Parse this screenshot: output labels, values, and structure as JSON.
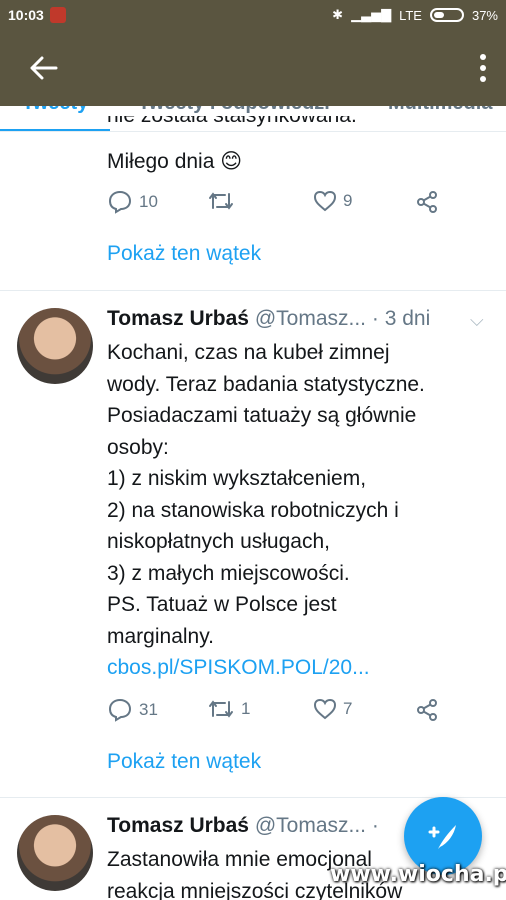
{
  "status_bar": {
    "time": "10:03",
    "network": "LTE",
    "battery": "37%"
  },
  "tabs": [
    "Tweety",
    "Tweety i odpowiedzi",
    "Multimedia"
  ],
  "tweets": [
    {
      "partial_text_1": "nie została stałsynkowana.",
      "partial_text_2": "Miłego dnia 😊",
      "replies": "10",
      "retweets": "",
      "likes": "9",
      "show_thread": "Pokaż ten wątek"
    },
    {
      "name": "Tomasz Urbaś",
      "handle": "@Tomasz...",
      "time": "· 3 dni",
      "text_lines": [
        "Kochani, czas na kubeł zimnej",
        "wody. Teraz badania statystyczne.",
        "Posiadaczami tatuaży są głównie",
        "osoby:",
        "1) z niskim wykształceniem,",
        "2) na stanowiska robotniczych i",
        "niskopłatnych usługach,",
        "3) z małych miejscowości.",
        "PS. Tatuaż w Polsce jest",
        "marginalny."
      ],
      "link": "cbos.pl/SPISKOM.POL/20...",
      "replies": "31",
      "retweets": "1",
      "likes": "7",
      "show_thread": "Pokaż ten wątek"
    },
    {
      "name": "Tomasz Urbaś",
      "handle": "@Tomasz...",
      "time": "·",
      "text_lines": [
        "Zastanowiła mnie emocjonal",
        "reakcja mniejszości czytelników"
      ]
    }
  ],
  "watermark": "www.wiocha.pl"
}
